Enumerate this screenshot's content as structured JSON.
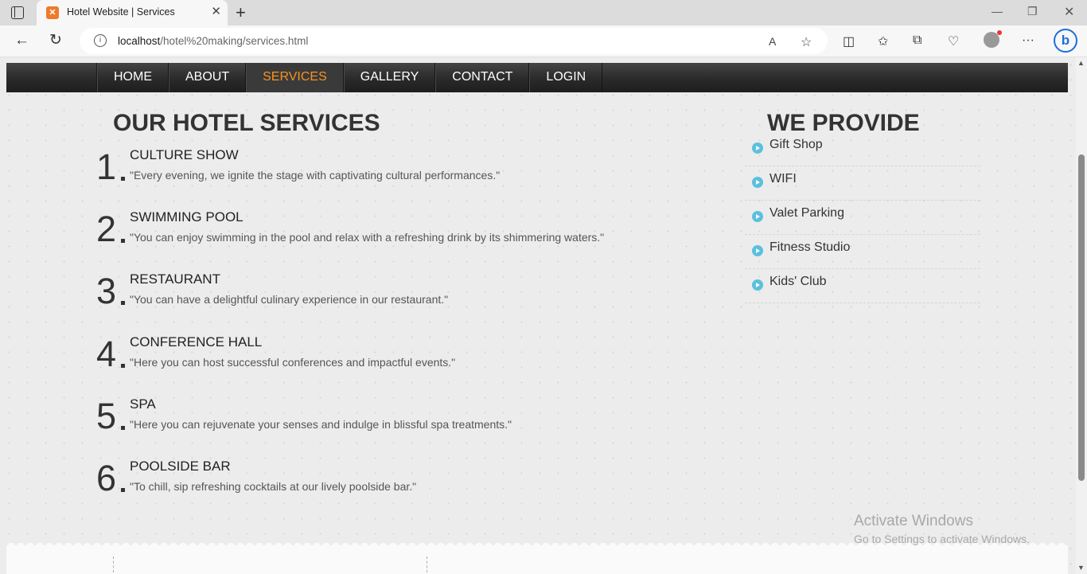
{
  "browser": {
    "tab_title": "Hotel Website | Services",
    "url_host": "localhost",
    "url_path": "/hotel%20making/services.html"
  },
  "nav": [
    {
      "label": "HOME",
      "active": false
    },
    {
      "label": "ABOUT",
      "active": false
    },
    {
      "label": "SERVICES",
      "active": true
    },
    {
      "label": "GALLERY",
      "active": false
    },
    {
      "label": "CONTACT",
      "active": false
    },
    {
      "label": "LOGIN",
      "active": false
    }
  ],
  "services_title": "OUR HOTEL SERVICES",
  "services": [
    {
      "number": "1",
      "name": "CULTURE SHOW",
      "description": "\"Every evening, we ignite the stage with captivating cultural performances.\""
    },
    {
      "number": "2",
      "name": "SWIMMING POOL",
      "description": "\"You can enjoy swimming in the pool and relax with a refreshing drink by its shimmering waters.\""
    },
    {
      "number": "3",
      "name": "RESTAURANT",
      "description": "\"You can have a delightful culinary experience in our restaurant.\""
    },
    {
      "number": "4",
      "name": "CONFERENCE HALL",
      "description": "\"Here you can host successful conferences and impactful events.\""
    },
    {
      "number": "5",
      "name": "SPA",
      "description": "\"Here you can rejuvenate your senses and indulge in blissful spa treatments.\""
    },
    {
      "number": "6",
      "name": "POOLSIDE BAR",
      "description": "\"To chill, sip refreshing cocktails at our lively poolside bar.\""
    }
  ],
  "provide_title": "WE PROVIDE",
  "provides": [
    "Gift Shop",
    "WIFI",
    "Valet Parking",
    "Fitness Studio",
    "Kids' Club"
  ],
  "watermark": {
    "title": "Activate Windows",
    "subtitle": "Go to Settings to activate Windows."
  },
  "colors": {
    "active_nav": "#f7931e",
    "bullet": "#5bc0de"
  }
}
